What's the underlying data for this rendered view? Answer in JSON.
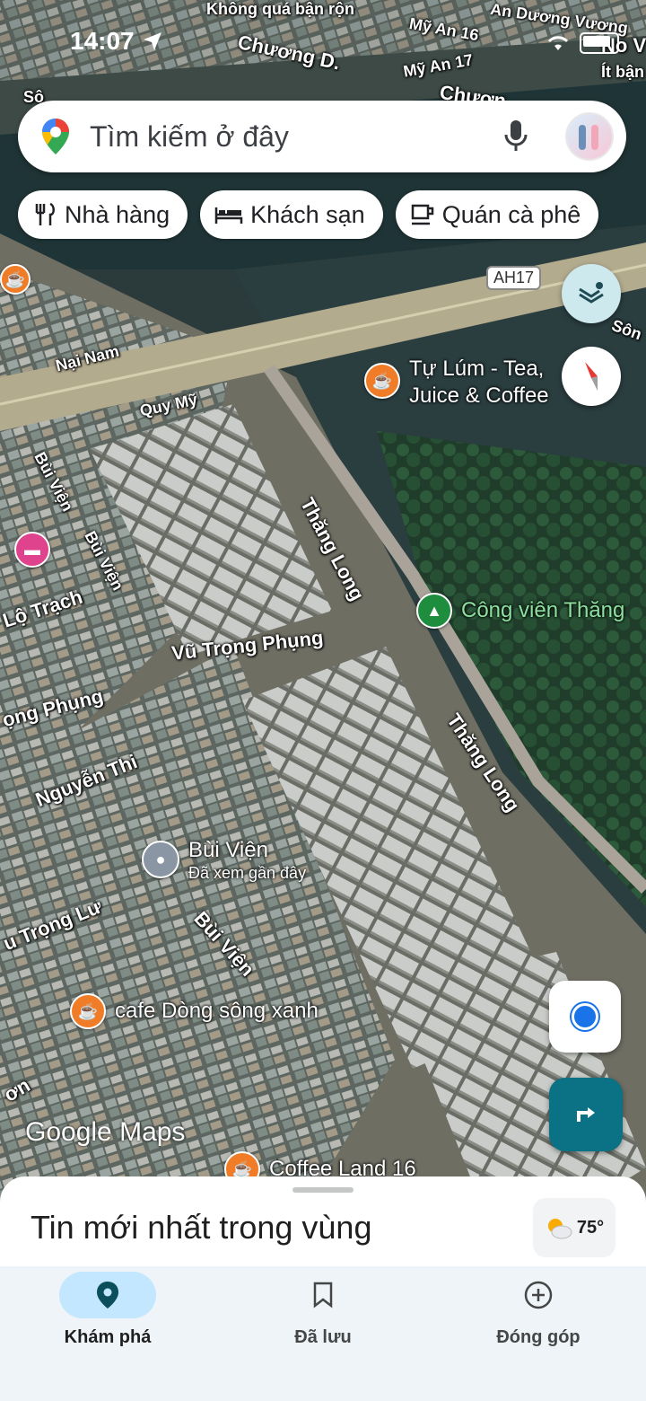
{
  "status_bar": {
    "time": "14:07"
  },
  "search": {
    "placeholder": "Tìm kiếm ở đây"
  },
  "chips": [
    {
      "label": "Nhà hàng",
      "icon": "restaurant-icon"
    },
    {
      "label": "Khách sạn",
      "icon": "hotel-icon"
    },
    {
      "label": "Quán cà phê",
      "icon": "coffee-icon"
    }
  ],
  "map": {
    "road_shield": "AH17",
    "streets": {
      "khong_qua_ban_ron": "Không quá bận rộn",
      "my_an_16": "Mỹ An 16",
      "an_duong_vuong": "An Dương Vương",
      "chuong_d": "Chương D.",
      "my_an_17": "Mỹ An 17",
      "chuong": "Chươn",
      "no_v": "No V",
      "it_ban": "Ít bận",
      "so_top": "Sô",
      "so_right": "Sôn",
      "nai_nam": "Nại Nam",
      "quy_my": "Quy Mỹ",
      "bui_vien_1": "Bùi Viện",
      "bui_vien_2": "Bùi Viện",
      "bui_vien_3": "Bùi Viện",
      "thang_long_1": "Thăng Long",
      "thang_long_2": "Thăng Long",
      "lo_trach": "Lộ Trạch",
      "vu_trong_phung_1": "Vũ Trọng Phụng",
      "vu_trong_phung_2": "ọng Phụng",
      "nguyen_thi": "Nguyễn Thi",
      "trong_lu": "u Trọng Lư",
      "on": "ơn"
    },
    "pois": {
      "tu_lum": "Tự Lúm - Tea, Juice & Coffee",
      "tu_lum_line1": "Tự Lúm - Tea,",
      "tu_lum_line2": "Juice & Coffee",
      "cong_vien": "Công viên Thăng",
      "bui_vien_place": "Bùi Viện",
      "bui_vien_sub": "Đã xem gần đây",
      "cafe_dong_song": "cafe Dòng sông xanh",
      "coffee_land": "Coffee Land 16"
    },
    "watermark": "Google Maps"
  },
  "sheet": {
    "title": "Tin mới nhất trong vùng",
    "weather": "75°"
  },
  "nav": [
    {
      "label": "Khám phá",
      "active": true
    },
    {
      "label": "Đã lưu",
      "active": false
    },
    {
      "label": "Đóng góp",
      "active": false
    }
  ],
  "colors": {
    "accent": "#0b7285",
    "active_pill": "#c2e7ff",
    "poi_orange": "#f07c27",
    "poi_pink": "#e0438d",
    "park_green": "#1e8e3e"
  }
}
